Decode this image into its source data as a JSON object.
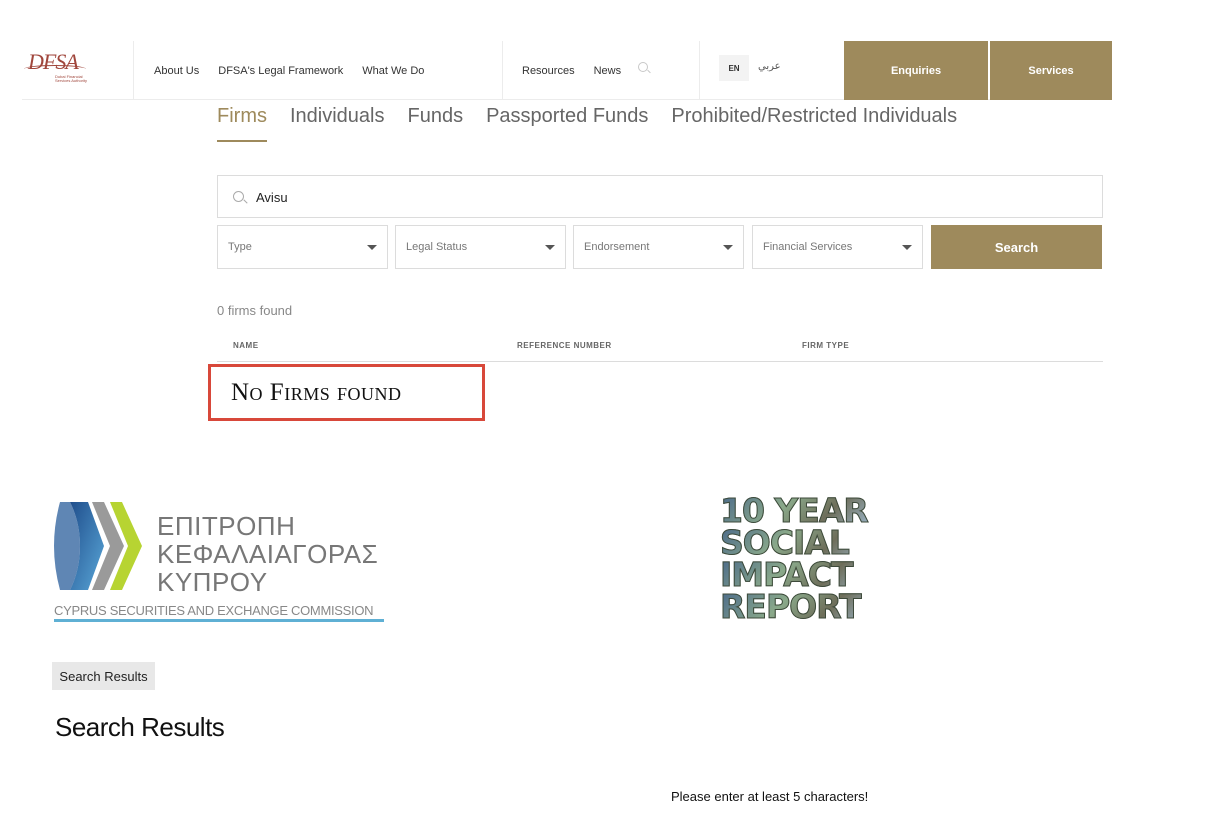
{
  "dfsa": {
    "logo_text": "DFSA",
    "logo_subtext": "Dubai Financial Services Authority",
    "nav": [
      "About Us",
      "DFSA's Legal Framework",
      "What We Do"
    ],
    "nav_secondary": [
      "Resources",
      "News"
    ],
    "lang_en": "EN",
    "lang_ar": "عربي",
    "enquiries_label": "Enquiries",
    "services_label": "Services",
    "brand_color": "#9e8a5c",
    "tabs": [
      "Firms",
      "Individuals",
      "Funds",
      "Passported Funds",
      "Prohibited/Restricted Individuals"
    ],
    "active_tab": "Firms",
    "search": {
      "value": "Avisu"
    },
    "filters": [
      "Type",
      "Legal Status",
      "Endorsement",
      "Financial Services"
    ],
    "search_button": "Search",
    "result_count": "0 firms found",
    "columns": [
      "NAME",
      "REFERENCE NUMBER",
      "FIRM TYPE"
    ],
    "empty_message": "No Firms found",
    "highlight_color": "#d8483a"
  },
  "cysec": {
    "title_lines": [
      "ΕΠΙΤΡΟΠΗ",
      "ΚΕΦΑΛΑΙΑΓΟΡΑΣ",
      "ΚΥΠΡΟΥ"
    ],
    "english_name": "CYPRUS SECURITIES AND EXCHANGE COMMISSION",
    "impact_lines": [
      "10 YEAR",
      "SOCIAL",
      "IMPACT",
      "REPORT"
    ],
    "breadcrumb": "Search Results",
    "page_title": "Search Results",
    "validation_message": "Please enter at least 5 characters!"
  }
}
